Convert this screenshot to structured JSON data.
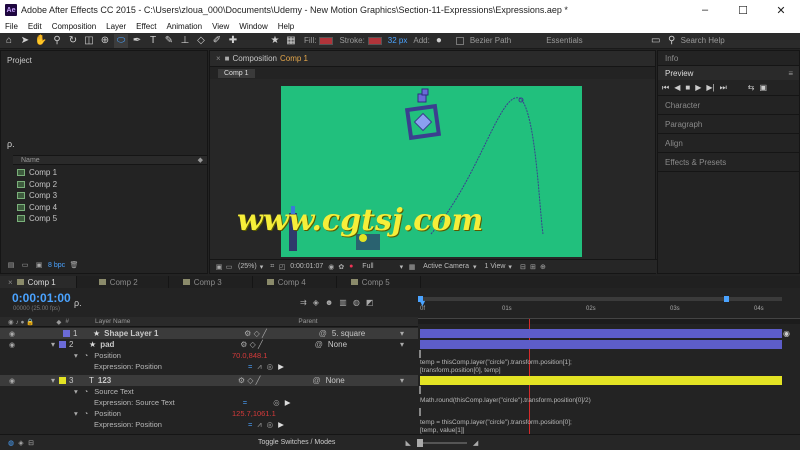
{
  "window": {
    "title": "Adobe After Effects CC 2015 - C:\\Users\\zloua_000\\Documents\\Udemy - New Motion Graphics\\Section-11-Expressions\\Expressions.aep *",
    "logo": "Ae",
    "minimize": "–",
    "maximize": "☐",
    "close": "✕"
  },
  "menu": [
    "File",
    "Edit",
    "Composition",
    "Layer",
    "Effect",
    "Animation",
    "View",
    "Window",
    "Help"
  ],
  "toolbar": {
    "fill_label": "Fill:",
    "stroke_label": "Stroke:",
    "stroke_width": "32 px",
    "add_label": "Add:",
    "bezier_label": "Bezier Path",
    "workspace": "Essentials",
    "search_placeholder": "Search Help",
    "fill_color": "#b0343a",
    "stroke_color": "#b0343a"
  },
  "project": {
    "title": "Project",
    "search": "ρ.",
    "name_header": "Name",
    "items": [
      "Comp 1",
      "Comp 2",
      "Comp 3",
      "Comp 4",
      "Comp 5"
    ],
    "bpc": "8 bpc"
  },
  "composition": {
    "title": "Composition",
    "name": "Comp 1",
    "tab": "Comp 1",
    "zoom": "(25%)",
    "timecode": "0:00:01:07",
    "resolution": "Full",
    "camera": "Active Camera",
    "views": "1 View",
    "bg_color": "#21c07d"
  },
  "right_panels": {
    "info": "Info",
    "preview": "Preview",
    "items": [
      "Character",
      "Paragraph",
      "Align",
      "Effects & Presets"
    ]
  },
  "timeline": {
    "tabs": [
      "Comp 1",
      "Comp 2",
      "Comp 3",
      "Comp 4",
      "Comp 5"
    ],
    "timecode": "0:00:01:00",
    "fps": "00000 (25.00 fps)",
    "search": "ρ.",
    "col_layer_name": "Layer Name",
    "col_parent": "Parent",
    "ruler": [
      "0f",
      "01s",
      "02s",
      "03s",
      "04s"
    ],
    "layers": [
      {
        "num": "1",
        "name": "Shape Layer 1",
        "parent": "5. square",
        "color": "#6b6bd8"
      },
      {
        "num": "2",
        "name": "pad",
        "parent": "None",
        "color": "#6b6bd8"
      },
      {
        "num": "3",
        "name": "123",
        "parent": "None",
        "color": "#e3e324"
      }
    ],
    "props": {
      "position": "Position",
      "pos_value_2": "70.0,848.1",
      "expr_position": "Expression: Position",
      "source_text": "Source Text",
      "expr_source_text": "Expression: Source Text",
      "position_3": "Position",
      "pos_value_3": "125.7,1061.1",
      "expr_position_3": "Expression: Position"
    },
    "expressions": [
      "temp = thisComp.layer(\"circle\").transform.position[1];",
      "[transform.position[0], temp]",
      "Math.round(thisComp.layer(\"circle\").transform.position[0]/2)",
      "temp = thisComp.layer(\"circle\").transform.position[0];",
      "[temp, value[1]]"
    ],
    "toggle": "Toggle Switches / Modes"
  },
  "watermark": "www.cgtsj.com"
}
